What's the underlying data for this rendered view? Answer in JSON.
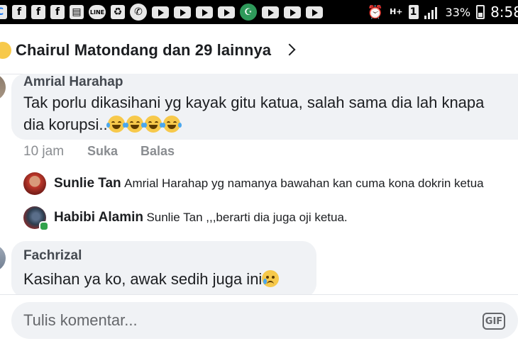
{
  "status_bar": {
    "notification_icons": [
      "facebook-icon",
      "facebook-icon",
      "facebook-icon",
      "print-icon",
      "line-app-icon",
      "recycle-icon",
      "whatsapp-icon",
      "youtube-icon",
      "youtube-icon",
      "youtube-icon",
      "youtube-icon",
      "muslim-app-icon",
      "youtube-icon",
      "youtube-icon",
      "youtube-icon"
    ],
    "network": "H+",
    "sim": "1",
    "battery": "33%",
    "time": "8:58"
  },
  "header": {
    "title": "Chairul Matondang dan 29 lainnya"
  },
  "comments": [
    {
      "author": "Amrial Harahap",
      "text_line1": "Tak porlu dikasihani yg kayak gitu katua, salah sama dia lah knapa",
      "text_line2": "dia korupsi..",
      "emoji": "😂😂😂😂",
      "time": "10 jam",
      "like": "Suka",
      "reply": "Balas",
      "replies": [
        {
          "name": "Sunlie Tan",
          "text": "Amrial Harahap  yg namanya bawahan kan cuma kona dokrin ketua"
        },
        {
          "name": "Habibi Alamin",
          "text": "Sunlie Tan ,,,berarti dia juga oji ketua."
        }
      ]
    },
    {
      "author": "Fachrizal",
      "text": "Kasihan ya ko, awak sedih juga ini",
      "emoji": "😥"
    }
  ],
  "composer": {
    "placeholder": "Tulis komentar...",
    "gif_label": "GIF"
  },
  "colors": {
    "bubble": "#f0f2f5",
    "meta_text": "#8a8d91",
    "online": "#31a24c"
  }
}
